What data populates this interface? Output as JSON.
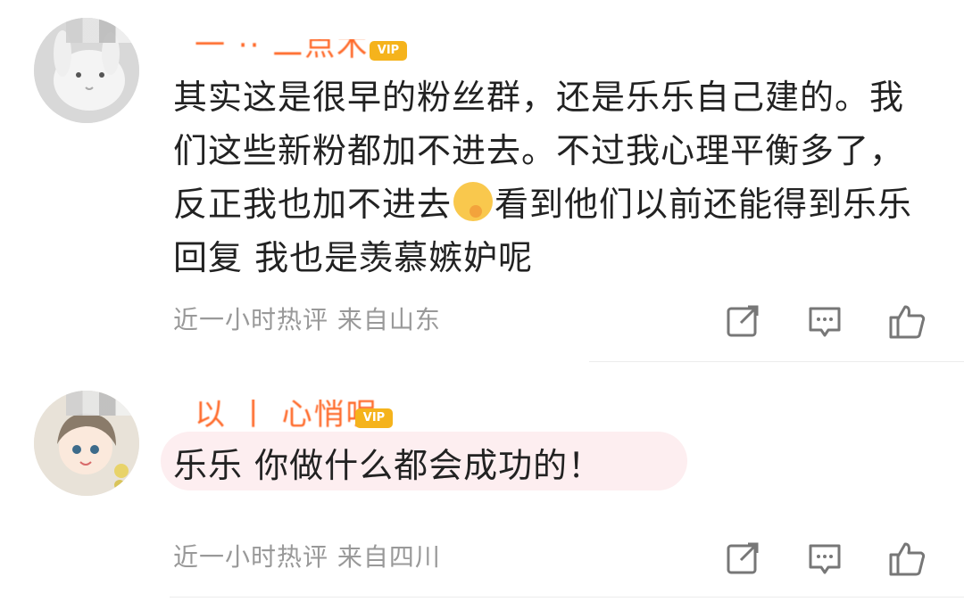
{
  "comments": [
    {
      "username": "一 ·· 二点木",
      "badge": "VIP",
      "text_parts": [
        "其实这是很早的粉丝群，还是乐乐自己建的。我们这些新粉都加不进去。不过我心理平衡多了，反正我也加不进去",
        "看到他们以前还能得到乐乐回复 我也是羡慕嫉妒呢"
      ],
      "emoji": "shush-face-icon",
      "meta": "近一小时热评  来自山东"
    },
    {
      "username": "以 丨 心悄呢",
      "badge": "VIP",
      "text_parts": [
        "乐乐 你做什么都会成功的！"
      ],
      "meta": "近一小时热评  来自四川"
    }
  ],
  "colors": {
    "username": "#ff8200",
    "meta": "#999999",
    "bubble": "#fdeef0"
  }
}
